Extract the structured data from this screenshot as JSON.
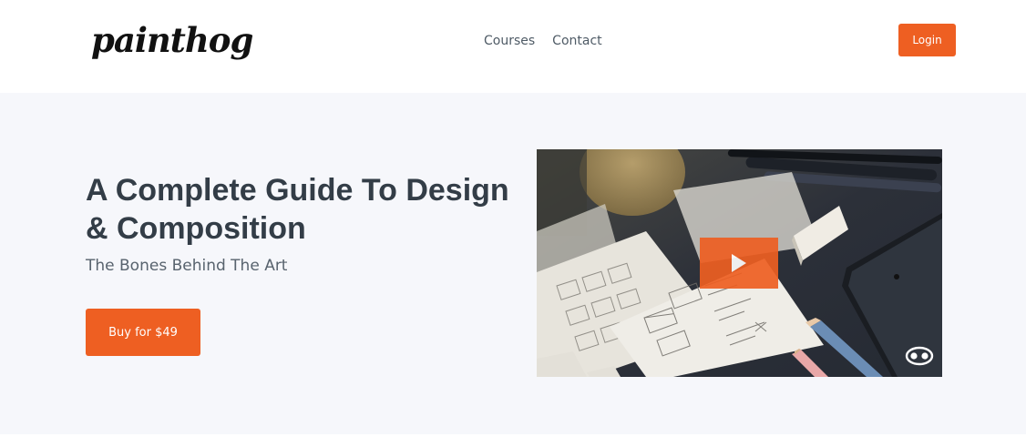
{
  "header": {
    "logo_text": "painthog",
    "nav": [
      {
        "label": "Courses"
      },
      {
        "label": "Contact"
      }
    ],
    "login_label": "Login"
  },
  "hero": {
    "title": "A Complete Guide To Design & Composition",
    "subtitle": "The Bones Behind The Art",
    "buy_label": "Buy for $49"
  },
  "video": {
    "icons": [
      "play-icon",
      "watermark-eyes-icon"
    ]
  },
  "colors": {
    "accent": "#ee5f22",
    "hero_bg": "#f6f7fb",
    "heading": "#333d47",
    "nav_text": "#4f5b66"
  }
}
